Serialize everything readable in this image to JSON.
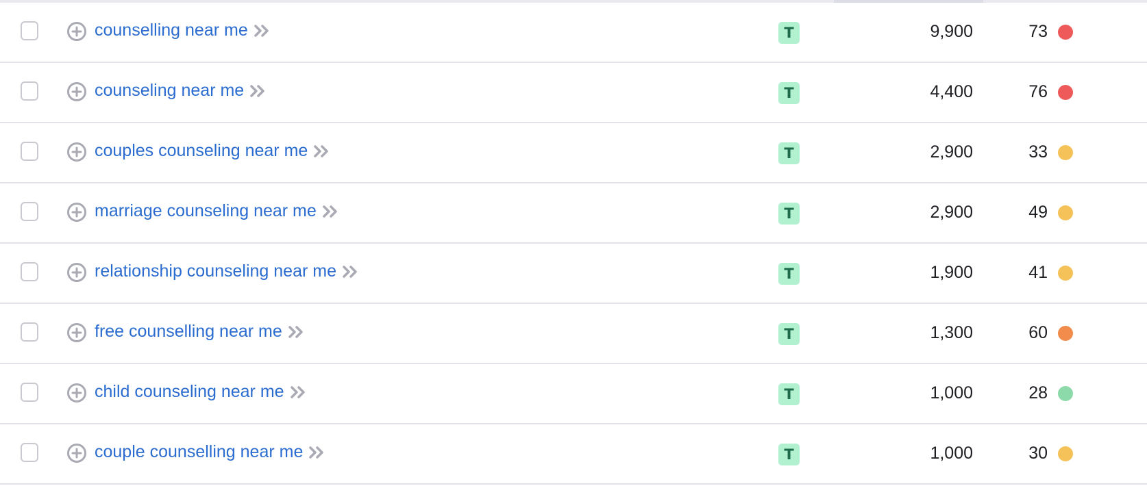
{
  "colors": {
    "link": "#2a6ccf",
    "kd_red": "#ee5a5a",
    "kd_orange": "#f18c4d",
    "kd_yellow": "#f5c25a",
    "kd_green": "#8cdaa9",
    "intent_badge_bg": "#b1f1cf"
  },
  "icons": {
    "add": "circle-plus-icon",
    "open": "double-chevron-right-icon"
  },
  "rows": [
    {
      "keyword": "counselling near me",
      "intent": "T",
      "volume": "9,900",
      "kd": "73",
      "kd_color": "#ee5a5a"
    },
    {
      "keyword": "counseling near me",
      "intent": "T",
      "volume": "4,400",
      "kd": "76",
      "kd_color": "#ee5a5a"
    },
    {
      "keyword": "couples counseling near me",
      "intent": "T",
      "volume": "2,900",
      "kd": "33",
      "kd_color": "#f5c25a"
    },
    {
      "keyword": "marriage counseling near me",
      "intent": "T",
      "volume": "2,900",
      "kd": "49",
      "kd_color": "#f5c25a"
    },
    {
      "keyword": "relationship counseling near me",
      "intent": "T",
      "volume": "1,900",
      "kd": "41",
      "kd_color": "#f5c25a"
    },
    {
      "keyword": "free counselling near me",
      "intent": "T",
      "volume": "1,300",
      "kd": "60",
      "kd_color": "#f18c4d"
    },
    {
      "keyword": "child counseling near me",
      "intent": "T",
      "volume": "1,000",
      "kd": "28",
      "kd_color": "#8cdaa9"
    },
    {
      "keyword": "couple counselling near me",
      "intent": "T",
      "volume": "1,000",
      "kd": "30",
      "kd_color": "#f5c25a"
    }
  ]
}
